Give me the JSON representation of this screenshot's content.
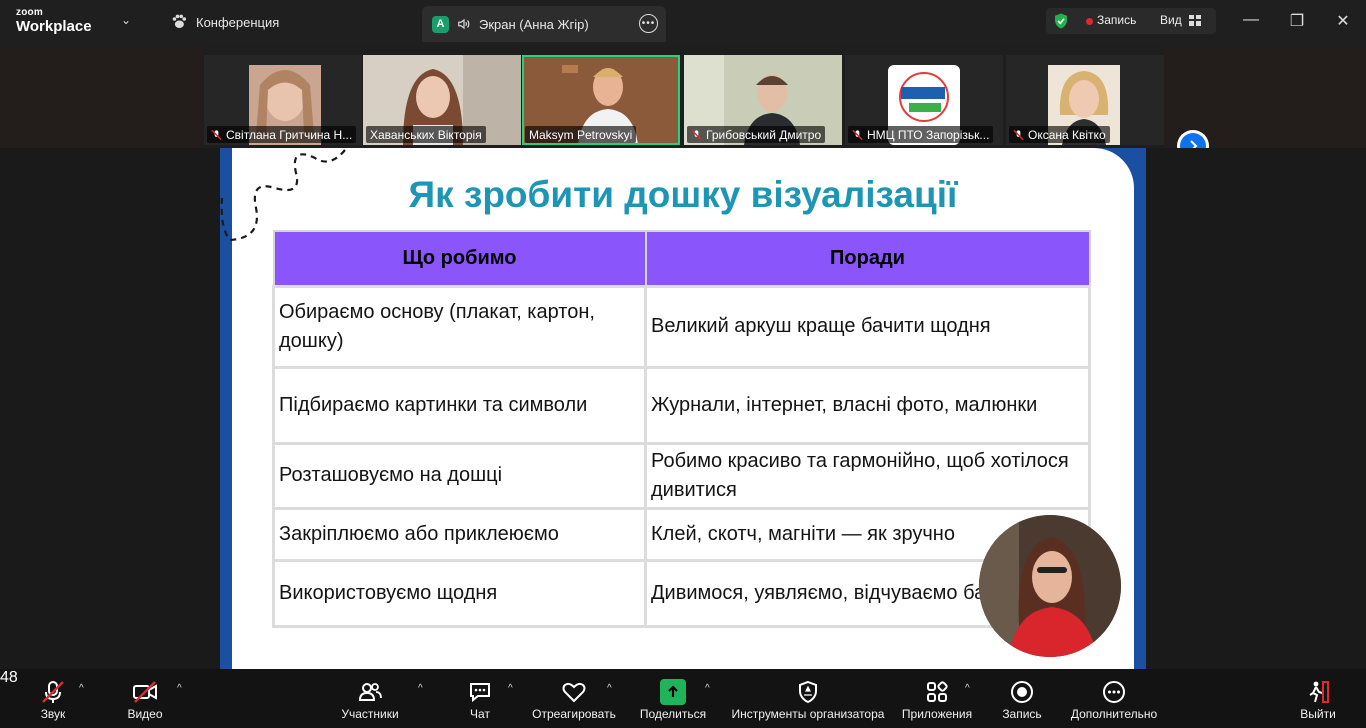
{
  "app": {
    "logo_top": "zoom",
    "logo_bottom": "Workplace",
    "meeting_label": "Конференция",
    "screen_tab_initial": "A",
    "screen_tab_label": "Экран (Анна Жгір)",
    "recording_label": "Запись",
    "view_label": "Вид"
  },
  "participants": [
    {
      "name": "Світлана Гритчина Н...",
      "muted": true
    },
    {
      "name": "Хаванських Вікторія",
      "muted": false
    },
    {
      "name": "Maksym Petrovskyi",
      "muted": false,
      "active": true
    },
    {
      "name": "Грибовський Дмитро",
      "muted": true
    },
    {
      "name": "НМЦ ПТО Запорізьк...",
      "muted": true
    },
    {
      "name": "Оксана Квітко",
      "muted": true
    }
  ],
  "slide": {
    "title": "Як зробити дошку візуалізації",
    "headers": [
      "Що робимо",
      "Поради"
    ],
    "rows": [
      [
        "Обираємо основу (плакат, картон, дошку)",
        "Великий аркуш краще бачити щодня"
      ],
      [
        "Підбираємо картинки та символи",
        "Журнали, інтернет, власні фото, малюнки"
      ],
      [
        "Розташовуємо на дошці",
        "Робимо красиво та гармонійно, щоб хотілося дивитися"
      ],
      [
        "Закріплюємо або приклеюємо",
        "Клей, скотч, магніти — як зручно"
      ],
      [
        "Використовуємо щодня",
        "Дивимося, уявляємо, відчуваємо бажання"
      ]
    ]
  },
  "toolbar": {
    "audio": "Звук",
    "video": "Видео",
    "participants": "Участники",
    "participants_count": "48",
    "chat": "Чат",
    "react": "Отреагировать",
    "share": "Поделиться",
    "host_tools": "Инструменты организатора",
    "apps": "Приложения",
    "record": "Запись",
    "more": "Дополнительно",
    "leave": "Выйти"
  },
  "colors": {
    "slide_title": "#1d96b6",
    "table_header": "#8a55fb",
    "slide_frame": "#1b4fa1",
    "active_speaker": "#26d07c",
    "share_green": "#1fb45b",
    "record_red": "#e0282e"
  }
}
